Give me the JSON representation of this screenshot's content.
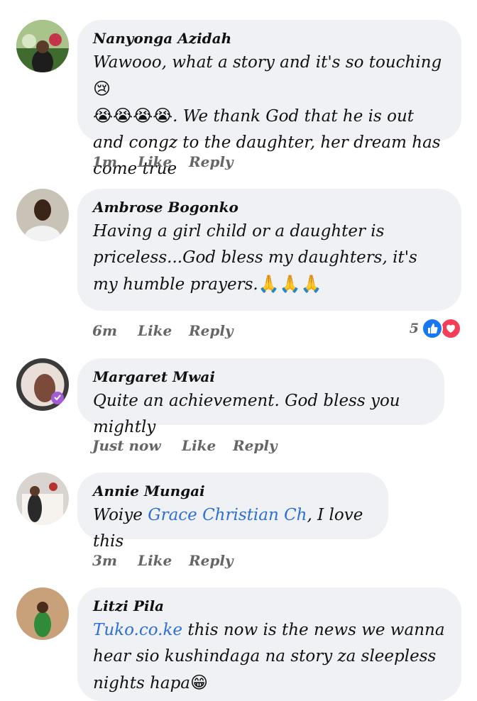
{
  "comments": [
    {
      "author": "Nanyonga Azidah",
      "text_parts": [
        "Wawooo, what a story and it's so touching ",
        "😢",
        " ",
        "😭😭😭😭",
        ". We thank God that he is out and congz to the daughter, her dream has come true"
      ],
      "time": "1m",
      "like": "Like",
      "reply": "Reply"
    },
    {
      "author": "Ambrose Bogonko",
      "text_parts": [
        "Having a girl child or a daughter is priceless...God bless my daughters, it's my humble prayers.",
        "🙏🙏🙏"
      ],
      "time": "6m",
      "like": "Like",
      "reply": "Reply",
      "reaction_count": "5"
    },
    {
      "author": "Margaret Mwai",
      "text": "Quite an achievement. God bless you mightly",
      "time": "Just now",
      "like": "Like",
      "reply": "Reply"
    },
    {
      "author": "Annie Mungai",
      "text_before": "Woiye ",
      "tag": "Grace Christian Ch",
      "text_after": ", I love this",
      "time": "3m",
      "like": "Like",
      "reply": "Reply"
    },
    {
      "author": "Litzi Pila",
      "tag": "Tuko.co.ke",
      "text_after": " this now is the news we wanna hear sio kushindaga na story za sleepless nights hapa",
      "emoji": "😁"
    }
  ],
  "colors": {
    "bubble": "#eff1f4",
    "link": "#2d6fd6",
    "like_reaction": "#1877f2",
    "love_reaction": "#f33e58",
    "meta_text": "#666666"
  },
  "icons": {
    "like_reaction": "thumbs-up-icon",
    "love_reaction": "heart-icon"
  }
}
